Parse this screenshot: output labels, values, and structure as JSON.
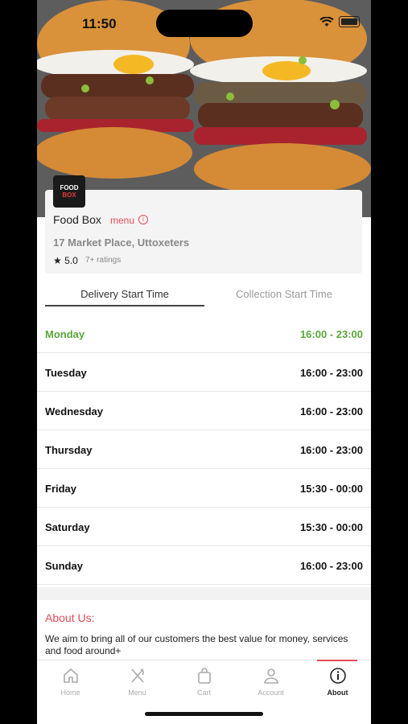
{
  "status": {
    "time": "11:50"
  },
  "restaurant": {
    "logo_text_line1": "FOOD",
    "logo_text_line2": "BOX",
    "name": "Food Box",
    "menu_label": "menu",
    "address": "17 Market Place, Uttoxeters",
    "rating": "5.0",
    "ratings_count": "7+ ratings"
  },
  "tabs": {
    "delivery": "Delivery Start Time",
    "collection": "Collection Start Time"
  },
  "hours": [
    {
      "day": "Monday",
      "range": "16:00 - 23:00",
      "today": true
    },
    {
      "day": "Tuesday",
      "range": "16:00 - 23:00",
      "today": false
    },
    {
      "day": "Wednesday",
      "range": "16:00 - 23:00",
      "today": false
    },
    {
      "day": "Thursday",
      "range": "16:00 - 23:00",
      "today": false
    },
    {
      "day": "Friday",
      "range": "15:30 - 00:00",
      "today": false
    },
    {
      "day": "Saturday",
      "range": "15:30 - 00:00",
      "today": false
    },
    {
      "day": "Sunday",
      "range": "16:00 - 23:00",
      "today": false
    }
  ],
  "about": {
    "title": "About Us:",
    "text": "We aim to bring all of our customers the best value for money, services and food around+"
  },
  "nav": {
    "home": "Home",
    "menu": "Menu",
    "cart": "Cart",
    "account": "Account",
    "about": "About"
  },
  "colors": {
    "accent": "#e34b5a",
    "today": "#5aa63b"
  }
}
